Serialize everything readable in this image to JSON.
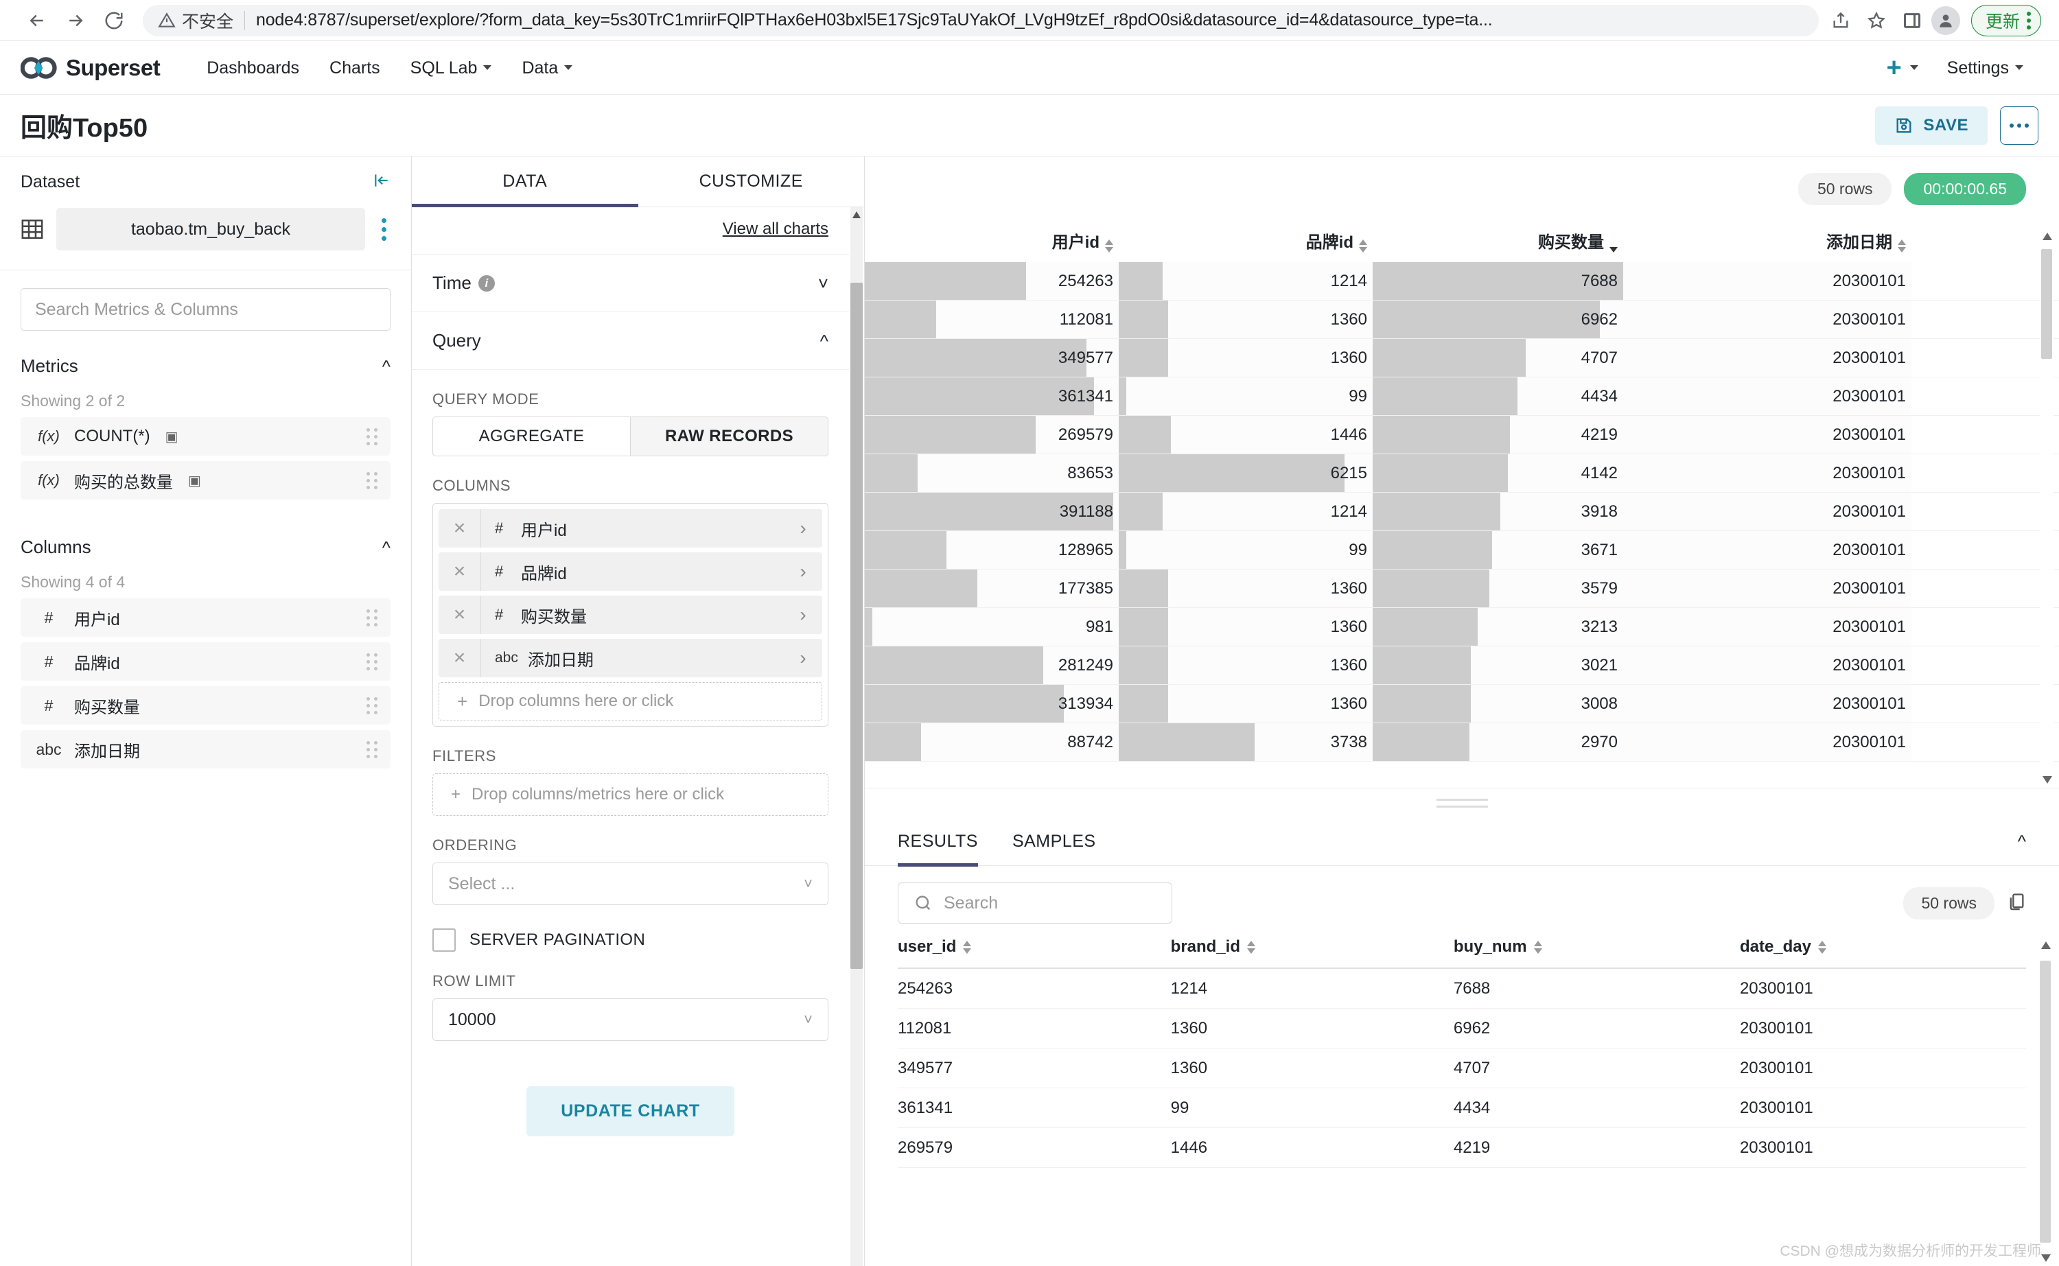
{
  "browser": {
    "security_label": "不安全",
    "url": "node4:8787/superset/explore/?form_data_key=5s30TrC1mriirFQlPTHax6eH03bxl5E17Sjc9TaUYakOf_LVgH9tzEf_r8pdO0si&datasource_id=4&datasource_type=ta...",
    "update_label": "更新"
  },
  "nav": {
    "brand": "Superset",
    "items": [
      {
        "label": "Dashboards",
        "has_caret": false
      },
      {
        "label": "Charts",
        "has_caret": false
      },
      {
        "label": "SQL Lab",
        "has_caret": true
      },
      {
        "label": "Data",
        "has_caret": true
      }
    ],
    "settings_label": "Settings"
  },
  "title_bar": {
    "chart_title": "回购Top50",
    "save_label": "SAVE"
  },
  "dataset_panel": {
    "heading": "Dataset",
    "dataset_name": "taobao.tm_buy_back",
    "search_placeholder": "Search Metrics & Columns",
    "metrics": {
      "heading": "Metrics",
      "showing": "Showing 2 of 2",
      "items": [
        {
          "type": "f(x)",
          "label": "COUNT(*)",
          "cert": "▣"
        },
        {
          "type": "f(x)",
          "label": "购买的总数量",
          "cert": "▣"
        }
      ]
    },
    "columns": {
      "heading": "Columns",
      "showing": "Showing 4 of 4",
      "items": [
        {
          "type": "#",
          "label": "用户id"
        },
        {
          "type": "#",
          "label": "品牌id"
        },
        {
          "type": "#",
          "label": "购买数量"
        },
        {
          "type": "abc",
          "label": "添加日期"
        }
      ]
    }
  },
  "control_panel": {
    "tabs": [
      {
        "label": "DATA",
        "active": true
      },
      {
        "label": "CUSTOMIZE",
        "active": false
      }
    ],
    "view_all_charts": "View all charts",
    "time_section": "Time",
    "query_section": "Query",
    "query_mode_label": "QUERY MODE",
    "query_modes": [
      {
        "label": "AGGREGATE",
        "active": false
      },
      {
        "label": "RAW RECORDS",
        "active": true
      }
    ],
    "columns_label": "COLUMNS",
    "columns_chips": [
      {
        "type": "#",
        "label": "用户id"
      },
      {
        "type": "#",
        "label": "品牌id"
      },
      {
        "type": "#",
        "label": "购买数量"
      },
      {
        "type": "abc",
        "label": "添加日期"
      }
    ],
    "columns_drop_hint": "Drop columns here or click",
    "filters_label": "FILTERS",
    "filters_drop_hint": "Drop columns/metrics here or click",
    "ordering_label": "ORDERING",
    "ordering_value": "Select ...",
    "server_pagination_label": "SERVER PAGINATION",
    "server_pagination_checked": false,
    "row_limit_label": "ROW LIMIT",
    "row_limit_value": "10000",
    "update_chart_label": "UPDATE CHART"
  },
  "chart": {
    "rows_badge": "50 rows",
    "time_badge": "00:00:00.65"
  },
  "results": {
    "tabs": [
      {
        "label": "RESULTS",
        "active": true
      },
      {
        "label": "SAMPLES",
        "active": false
      }
    ],
    "search_placeholder": "Search",
    "rows_badge": "50 rows"
  },
  "watermark": "CSDN @想成为数据分析师的开发工程师",
  "chart_data": {
    "type": "table",
    "title": "回购Top50",
    "columns": [
      {
        "key": "用户id",
        "label": "用户id",
        "sort": "none",
        "bar": true,
        "max": 400000
      },
      {
        "key": "品牌id",
        "label": "品牌id",
        "sort": "none",
        "bar": true,
        "max": 7000
      },
      {
        "key": "购买数量",
        "label": "购买数量",
        "sort": "desc",
        "bar": true,
        "max": 7688
      },
      {
        "key": "添加日期",
        "label": "添加日期",
        "sort": "none",
        "bar": false
      }
    ],
    "rows": [
      {
        "用户id": 254263,
        "品牌id": 1214,
        "购买数量": 7688,
        "添加日期": "20300101"
      },
      {
        "用户id": 112081,
        "品牌id": 1360,
        "购买数量": 6962,
        "添加日期": "20300101"
      },
      {
        "用户id": 349577,
        "品牌id": 1360,
        "购买数量": 4707,
        "添加日期": "20300101"
      },
      {
        "用户id": 361341,
        "品牌id": 99,
        "购买数量": 4434,
        "添加日期": "20300101"
      },
      {
        "用户id": 269579,
        "品牌id": 1446,
        "购买数量": 4219,
        "添加日期": "20300101"
      },
      {
        "用户id": 83653,
        "品牌id": 6215,
        "购买数量": 4142,
        "添加日期": "20300101"
      },
      {
        "用户id": 391188,
        "品牌id": 1214,
        "购买数量": 3918,
        "添加日期": "20300101"
      },
      {
        "用户id": 128965,
        "品牌id": 99,
        "购买数量": 3671,
        "添加日期": "20300101"
      },
      {
        "用户id": 177385,
        "品牌id": 1360,
        "购买数量": 3579,
        "添加日期": "20300101"
      },
      {
        "用户id": 981,
        "品牌id": 1360,
        "购买数量": 3213,
        "添加日期": "20300101"
      },
      {
        "用户id": 281249,
        "品牌id": 1360,
        "购买数量": 3021,
        "添加日期": "20300101"
      },
      {
        "用户id": 313934,
        "品牌id": 1360,
        "购买数量": 3008,
        "添加日期": "20300101"
      },
      {
        "用户id": 88742,
        "品牌id": 3738,
        "购买数量": 2970,
        "添加日期": "20300101"
      }
    ],
    "total_rows": 50,
    "query_time": "00:00:00.65"
  },
  "results_data": {
    "type": "table",
    "columns": [
      "user_id",
      "brand_id",
      "buy_num",
      "date_day"
    ],
    "rows": [
      [
        "254263",
        "1214",
        "7688",
        "20300101"
      ],
      [
        "112081",
        "1360",
        "6962",
        "20300101"
      ],
      [
        "349577",
        "1360",
        "4707",
        "20300101"
      ],
      [
        "361341",
        "99",
        "4434",
        "20300101"
      ],
      [
        "269579",
        "1446",
        "4219",
        "20300101"
      ]
    ],
    "total_rows": 50
  }
}
